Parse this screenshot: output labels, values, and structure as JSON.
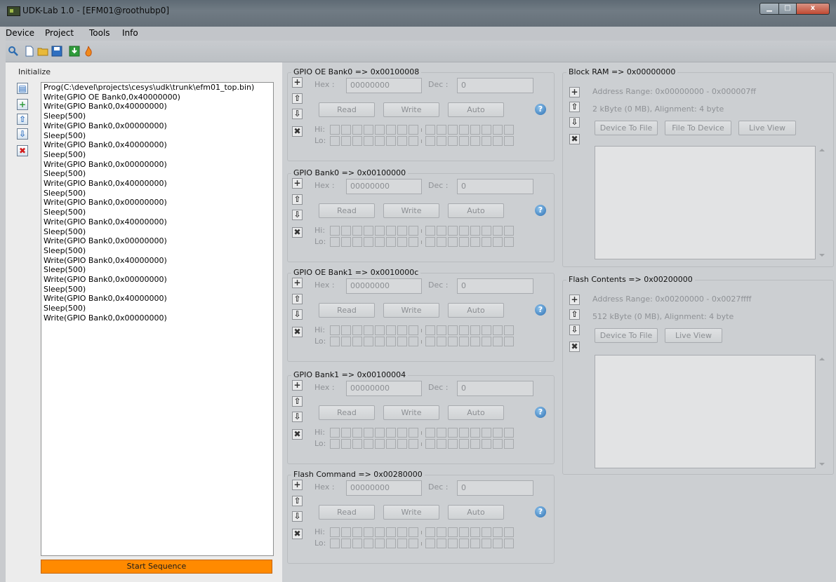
{
  "window": {
    "title": "UDK-Lab 1.0 - [EFM01@roothubp0]",
    "min": "▁",
    "max": "□",
    "close": "x"
  },
  "menu": [
    "Device",
    "Project",
    "Tools",
    "Info"
  ],
  "toolbar": {
    "icons": [
      "search-icon",
      "new-file-icon",
      "open-folder-icon",
      "save-icon",
      "download-icon",
      "fire-icon"
    ]
  },
  "left": {
    "label": "Initialize",
    "sequence": [
      "Prog(C:\\devel\\projects\\cesys\\udk\\trunk\\efm01_top.bin)",
      "Write(GPIO OE Bank0,0x40000000)",
      "Write(GPIO Bank0,0x40000000)",
      "Sleep(500)",
      "Write(GPIO Bank0,0x00000000)",
      "Sleep(500)",
      "Write(GPIO Bank0,0x40000000)",
      "Sleep(500)",
      "Write(GPIO Bank0,0x00000000)",
      "Sleep(500)",
      "Write(GPIO Bank0,0x40000000)",
      "Sleep(500)",
      "Write(GPIO Bank0,0x00000000)",
      "Sleep(500)",
      "Write(GPIO Bank0,0x40000000)",
      "Sleep(500)",
      "Write(GPIO Bank0,0x00000000)",
      "Sleep(500)",
      "Write(GPIO Bank0,0x40000000)",
      "Sleep(500)",
      "Write(GPIO Bank0,0x00000000)",
      "Sleep(500)",
      "Write(GPIO Bank0,0x40000000)",
      "Sleep(500)",
      "Write(GPIO Bank0,0x00000000)"
    ],
    "start_label": "Start Sequence"
  },
  "registers": [
    {
      "title": "GPIO OE Bank0 => 0x00100008",
      "hex_label": "Hex :",
      "hex": "00000000",
      "dec_label": "Dec :",
      "dec": "0",
      "read": "Read",
      "write": "Write",
      "auto": "Auto",
      "hi": "Hi:",
      "lo": "Lo:"
    },
    {
      "title": "GPIO Bank0 => 0x00100000",
      "hex_label": "Hex :",
      "hex": "00000000",
      "dec_label": "Dec :",
      "dec": "0",
      "read": "Read",
      "write": "Write",
      "auto": "Auto",
      "hi": "Hi:",
      "lo": "Lo:"
    },
    {
      "title": "GPIO OE Bank1 => 0x0010000c",
      "hex_label": "Hex :",
      "hex": "00000000",
      "dec_label": "Dec :",
      "dec": "0",
      "read": "Read",
      "write": "Write",
      "auto": "Auto",
      "hi": "Hi:",
      "lo": "Lo:"
    },
    {
      "title": "GPIO Bank1 => 0x00100004",
      "hex_label": "Hex :",
      "hex": "00000000",
      "dec_label": "Dec :",
      "dec": "0",
      "read": "Read",
      "write": "Write",
      "auto": "Auto",
      "hi": "Hi:",
      "lo": "Lo:"
    },
    {
      "title": "Flash Command => 0x00280000",
      "hex_label": "Hex :",
      "hex": "00000000",
      "dec_label": "Dec :",
      "dec": "0",
      "read": "Read",
      "write": "Write",
      "auto": "Auto",
      "hi": "Hi:",
      "lo": "Lo:"
    }
  ],
  "memories": [
    {
      "title": "Block RAM => 0x00000000",
      "range": "Address Range: 0x00000000 - 0x000007ff",
      "size": "2 kByte (0 MB), Alignment: 4 byte",
      "buttons": [
        "Device To File",
        "File To Device",
        "Live View"
      ]
    },
    {
      "title": "Flash Contents => 0x00200000",
      "range": "Address Range: 0x00200000 - 0x0027ffff",
      "size": "512 kByte (0 MB), Alignment: 4 byte",
      "buttons": [
        "Device To File",
        "Live View"
      ]
    }
  ],
  "glyphs": {
    "add": "+",
    "up": "⇧",
    "down": "⇩",
    "remove": "✖",
    "help": "?",
    "new": "▤"
  }
}
